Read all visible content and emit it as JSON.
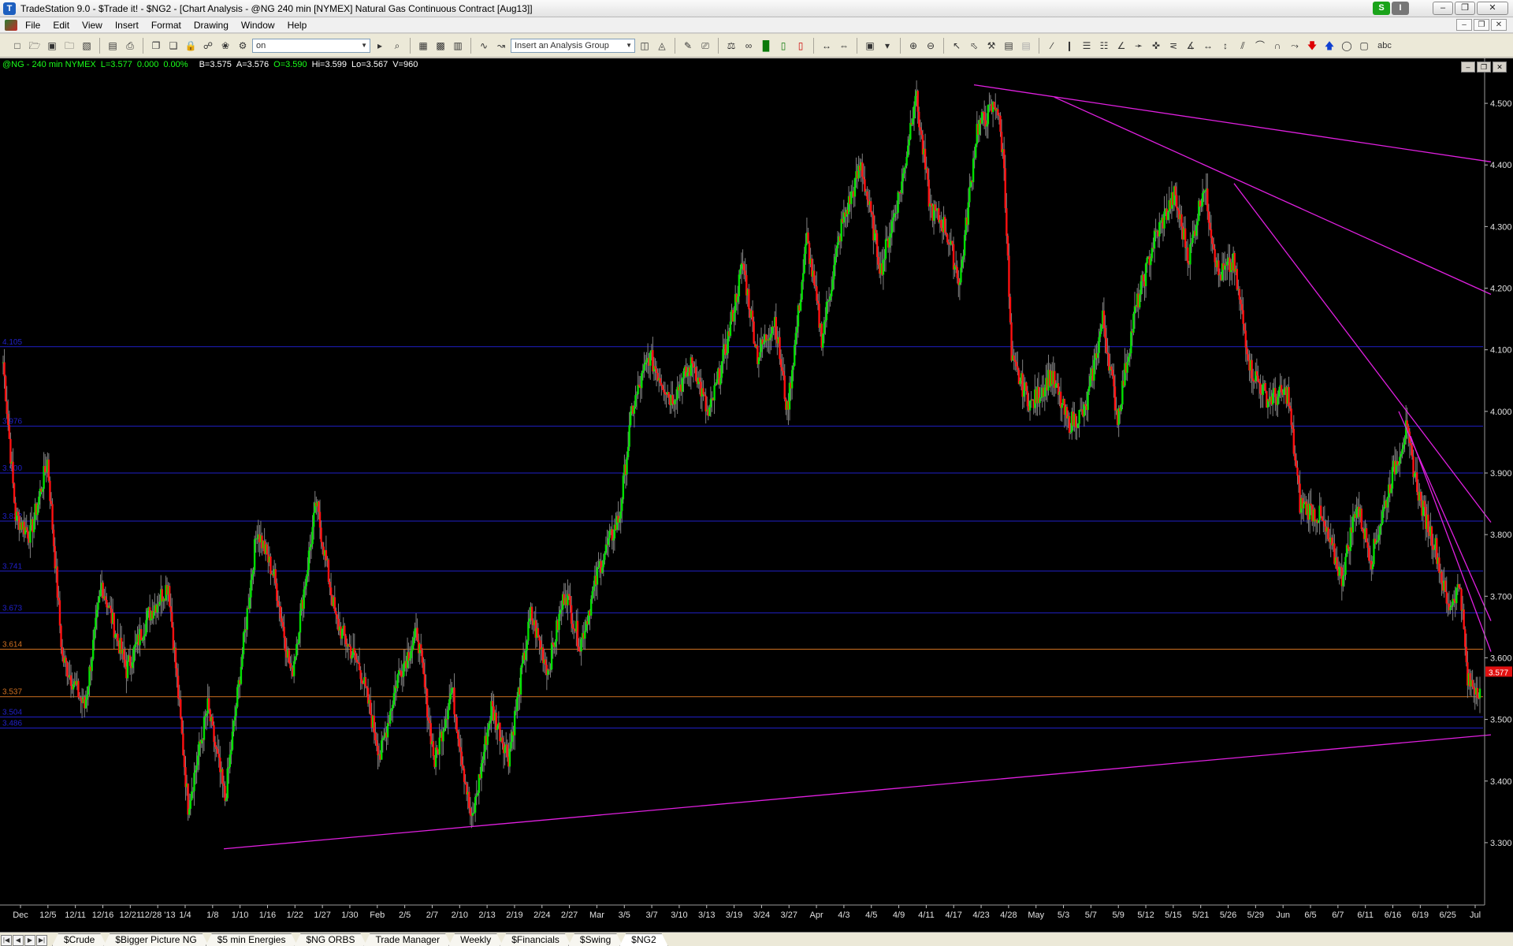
{
  "window": {
    "title": "TradeStation 9.0 - $Trade it! - $NG2 - [Chart Analysis - @NG 240 min [NYMEX] Natural Gas Continuous Contract [Aug13]]",
    "badge_s": "S",
    "badge_i": "I"
  },
  "menu": [
    "File",
    "Edit",
    "View",
    "Insert",
    "Format",
    "Drawing",
    "Window",
    "Help"
  ],
  "toolbar": {
    "symbol_value": "on",
    "analysis_placeholder": "Insert an Analysis Group",
    "text_tool": "abc"
  },
  "chart_header": {
    "symbol": "@NG - 240 min  NYMEX",
    "last": "L=3.577",
    "change": "0.000",
    "pct": "0.00%",
    "bid": "B=3.575",
    "ask": "A=3.576",
    "open": "O=3.590",
    "high": "Hi=3.599",
    "low": "Lo=3.567",
    "volume": "V=960"
  },
  "price_axis": [
    "4.500",
    "4.400",
    "4.300",
    "4.200",
    "4.100",
    "4.000",
    "3.900",
    "3.800",
    "3.700",
    "3.600",
    "3.500",
    "3.400",
    "3.300"
  ],
  "current_price": "3.577",
  "level_labels": [
    {
      "label": "4.105",
      "value": 4.105,
      "color": "#2020c8"
    },
    {
      "label": "3.976",
      "value": 3.976,
      "color": "#2020c8"
    },
    {
      "label": "3.900",
      "value": 3.9,
      "color": "#2020c8"
    },
    {
      "label": "3.822",
      "value": 3.822,
      "color": "#2020c8"
    },
    {
      "label": "3.741",
      "value": 3.741,
      "color": "#2020c8"
    },
    {
      "label": "3.673",
      "value": 3.673,
      "color": "#2020c8"
    },
    {
      "label": "3.614",
      "value": 3.614,
      "color": "#d07020"
    },
    {
      "label": "3.537",
      "value": 3.537,
      "color": "#d07020"
    },
    {
      "label": "3.504",
      "value": 3.504,
      "color": "#2020c8"
    },
    {
      "label": "3.486",
      "value": 3.486,
      "color": "#2020c8"
    }
  ],
  "date_axis": [
    "Dec",
    "12/5",
    "12/11",
    "12/16",
    "12/21",
    "12/28 '13",
    "1/4",
    "1/8",
    "1/10",
    "1/16",
    "1/22",
    "1/27",
    "1/30",
    "Feb",
    "2/5",
    "2/7",
    "2/10",
    "2/13",
    "2/19",
    "2/24",
    "2/27",
    "Mar",
    "3/5",
    "3/7",
    "3/10",
    "3/13",
    "3/19",
    "3/24",
    "3/27",
    "Apr",
    "4/3",
    "4/5",
    "4/9",
    "4/11",
    "4/17",
    "4/23",
    "4/28",
    "May",
    "5/3",
    "5/7",
    "5/9",
    "5/12",
    "5/15",
    "5/21",
    "5/26",
    "5/29",
    "Jun",
    "6/5",
    "6/7",
    "6/11",
    "6/16",
    "6/19",
    "6/25",
    "Jul"
  ],
  "chart_data": {
    "type": "candlestick",
    "y_range": [
      3.25,
      4.55
    ],
    "bars_per_label": 6,
    "anchors": [
      [
        0,
        4.08
      ],
      [
        10,
        3.83
      ],
      [
        22,
        3.8
      ],
      [
        36,
        3.92
      ],
      [
        48,
        3.6
      ],
      [
        66,
        3.52
      ],
      [
        80,
        3.72
      ],
      [
        100,
        3.58
      ],
      [
        118,
        3.67
      ],
      [
        134,
        3.72
      ],
      [
        150,
        3.36
      ],
      [
        166,
        3.52
      ],
      [
        180,
        3.37
      ],
      [
        206,
        3.81
      ],
      [
        220,
        3.73
      ],
      [
        234,
        3.57
      ],
      [
        254,
        3.85
      ],
      [
        270,
        3.66
      ],
      [
        290,
        3.58
      ],
      [
        306,
        3.44
      ],
      [
        320,
        3.57
      ],
      [
        336,
        3.64
      ],
      [
        350,
        3.43
      ],
      [
        364,
        3.55
      ],
      [
        380,
        3.33
      ],
      [
        396,
        3.52
      ],
      [
        410,
        3.44
      ],
      [
        428,
        3.67
      ],
      [
        442,
        3.58
      ],
      [
        456,
        3.71
      ],
      [
        468,
        3.62
      ],
      [
        484,
        3.75
      ],
      [
        500,
        3.83
      ],
      [
        510,
        4.0
      ],
      [
        524,
        4.09
      ],
      [
        542,
        4.02
      ],
      [
        560,
        4.08
      ],
      [
        572,
        3.99
      ],
      [
        586,
        4.1
      ],
      [
        600,
        4.24
      ],
      [
        612,
        4.09
      ],
      [
        626,
        4.15
      ],
      [
        636,
        4.0
      ],
      [
        652,
        4.28
      ],
      [
        664,
        4.12
      ],
      [
        680,
        4.3
      ],
      [
        696,
        4.4
      ],
      [
        712,
        4.23
      ],
      [
        730,
        4.38
      ],
      [
        740,
        4.52
      ],
      [
        752,
        4.33
      ],
      [
        764,
        4.3
      ],
      [
        776,
        4.21
      ],
      [
        790,
        4.46
      ],
      [
        806,
        4.5
      ],
      [
        812,
        4.4
      ],
      [
        818,
        4.08
      ],
      [
        834,
        4.01
      ],
      [
        850,
        4.06
      ],
      [
        864,
        3.98
      ],
      [
        878,
        4.0
      ],
      [
        892,
        4.15
      ],
      [
        904,
        3.99
      ],
      [
        918,
        4.16
      ],
      [
        934,
        4.28
      ],
      [
        950,
        4.35
      ],
      [
        962,
        4.25
      ],
      [
        974,
        4.37
      ],
      [
        986,
        4.22
      ],
      [
        998,
        4.24
      ],
      [
        1012,
        4.07
      ],
      [
        1026,
        4.02
      ],
      [
        1042,
        4.03
      ],
      [
        1052,
        3.85
      ],
      [
        1068,
        3.83
      ],
      [
        1086,
        3.73
      ],
      [
        1098,
        3.85
      ],
      [
        1110,
        3.76
      ],
      [
        1126,
        3.89
      ],
      [
        1138,
        3.97
      ],
      [
        1150,
        3.85
      ],
      [
        1162,
        3.78
      ],
      [
        1172,
        3.68
      ],
      [
        1182,
        3.72
      ],
      [
        1188,
        3.56
      ],
      [
        1198,
        3.55
      ]
    ],
    "trendlines": [
      {
        "x1": 1236,
        "y1": 4.53,
        "x2": 1892,
        "y2": 4.405
      },
      {
        "x1": 1338,
        "y1": 4.51,
        "x2": 1892,
        "y2": 4.19
      },
      {
        "x1": 1566,
        "y1": 4.37,
        "x2": 1892,
        "y2": 3.82
      },
      {
        "x1": 1775,
        "y1": 4.0,
        "x2": 1892,
        "y2": 3.66
      },
      {
        "x1": 1790,
        "y1": 3.96,
        "x2": 1892,
        "y2": 3.61
      },
      {
        "x1": 284,
        "y1": 3.29,
        "x2": 1892,
        "y2": 3.475
      }
    ]
  },
  "tabs": [
    "$Crude",
    "$Bigger Picture NG",
    "$5 min Energies",
    "$NG ORBS",
    "Trade Manager",
    "Weekly",
    "$Financials",
    "$Swing",
    "$NG2"
  ],
  "active_tab": "$NG2"
}
